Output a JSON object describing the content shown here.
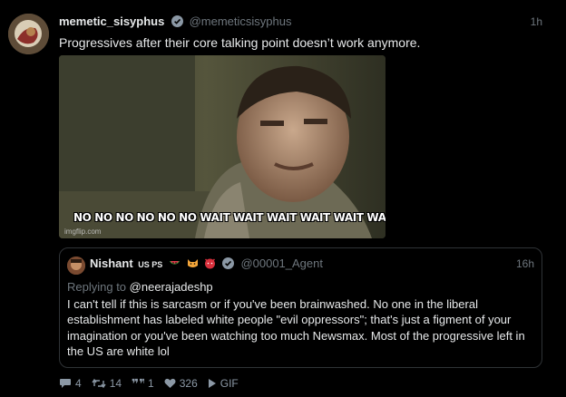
{
  "tweet": {
    "author_name": "memetic_sisyphus",
    "author_handle": "@memeticsisyphus",
    "time": "1h",
    "text": "Progressives after their core talking point doesn’t work anymore.",
    "media": {
      "caption": "NO NO NO NO NO NO WAIT WAIT WAIT WAIT WAIT WAIT",
      "watermark": "imgflip.com"
    }
  },
  "quote": {
    "author_name": "Nishant",
    "name_suffix": "US PS",
    "emoji_icons": [
      "watermelon-icon",
      "cat-face-icon",
      "angry-devil-icon"
    ],
    "author_handle": "@00001_Agent",
    "time": "16h",
    "replying_prefix": "Replying to",
    "replying_to": "@neerajadeshp",
    "text": "I can't tell if this is sarcasm or if you've been brainwashed. No one in the liberal establishment has labeled white people \"evil oppressors\"; that's just a figment of your imagination or you've been watching too much Newsmax. Most of the progressive left in the US are white lol"
  },
  "actions": {
    "replies": "4",
    "retweets": "14",
    "quotes": "1",
    "likes": "326",
    "gif_label": "GIF"
  },
  "colors": {
    "background": "#000000",
    "text": "#e7e9ea",
    "muted": "#6e767d",
    "border": "#2f3336",
    "verified": "#8b98a5"
  }
}
